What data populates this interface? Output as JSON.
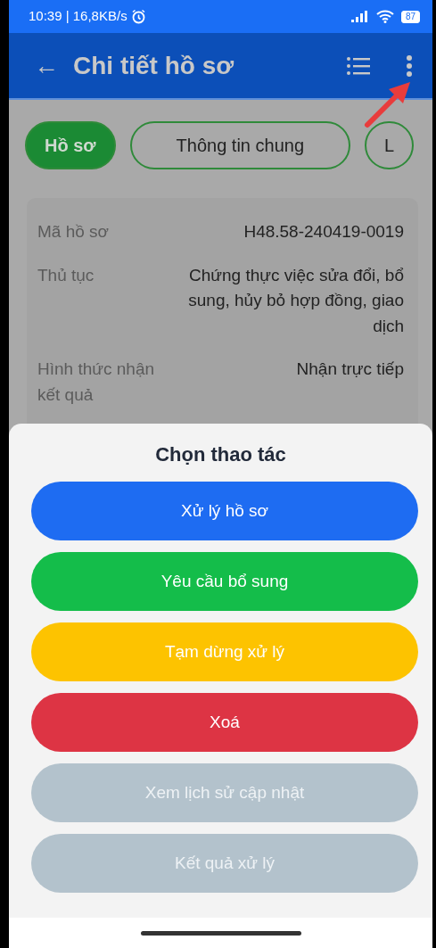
{
  "status_bar": {
    "time": "10:39 | 16,8KB/s",
    "battery": "87"
  },
  "app_bar": {
    "back": "←",
    "title": "Chi tiết hồ sơ"
  },
  "tabs": [
    {
      "label": "Hồ sơ",
      "selected": true
    },
    {
      "label": "Thông tin chung",
      "selected": false
    },
    {
      "label": "L",
      "selected": false
    }
  ],
  "details": [
    {
      "label": "Mã hồ sơ",
      "value": "H48.58-240419-0019"
    },
    {
      "label": "Thủ tục",
      "value": "Chứng thực việc sửa đổi, bổ sung, hủy bỏ hợp đồng, giao dịch"
    },
    {
      "label": "Hình thức nhận kết quả",
      "value": "Nhận trực tiếp"
    }
  ],
  "sheet": {
    "title": "Chọn thao tác",
    "actions": [
      {
        "label": "Xử lý hồ sơ",
        "color": "#1e6cf2",
        "disabled": false
      },
      {
        "label": "Yêu cầu bổ sung",
        "color": "#14bd4a",
        "disabled": false
      },
      {
        "label": "Tạm dừng xử lý",
        "color": "#fdc300",
        "disabled": false
      },
      {
        "label": "Xoá",
        "color": "#dd3444",
        "disabled": false
      },
      {
        "label": "Xem lịch sử cập nhật",
        "color": "#b3c2cc",
        "disabled": true
      },
      {
        "label": "Kết quả xử lý",
        "color": "#b3c2cc",
        "disabled": true
      }
    ]
  }
}
